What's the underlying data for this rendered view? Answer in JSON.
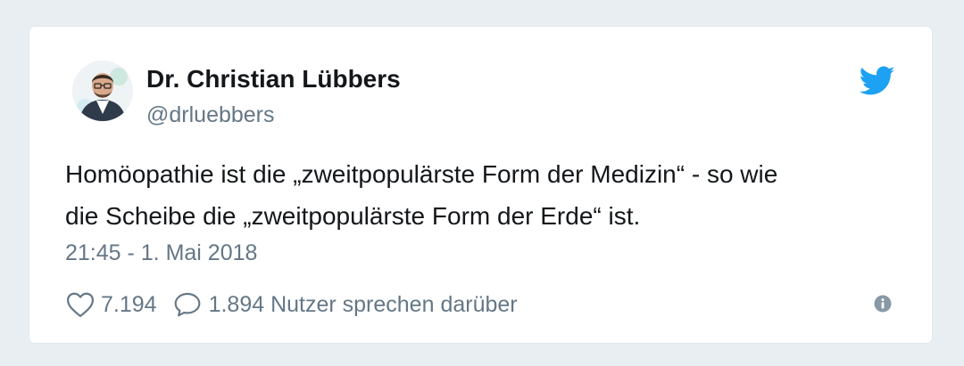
{
  "tweet": {
    "author": {
      "display_name": "Dr. Christian Lübbers",
      "handle": "@drluebbers",
      "avatar_icon": "person-avatar"
    },
    "text_line_1": "Homöopathie ist die „zweitpopulärste Form der Medizin“ - so wie",
    "text_line_2": "die Scheibe die „zweitpopulärste Form der Erde“ ist.",
    "timestamp": "21:45 - 1. Mai 2018",
    "likes": "7.194",
    "replies_text": "1.894 Nutzer sprechen darüber",
    "icons": {
      "brand": "twitter-bird-icon",
      "like": "heart-icon",
      "reply": "speech-bubble-icon",
      "info": "info-icon"
    },
    "colors": {
      "brand": "#1da1f2",
      "text": "#14171a",
      "secondary": "#657786",
      "info": "#8899a6"
    }
  }
}
